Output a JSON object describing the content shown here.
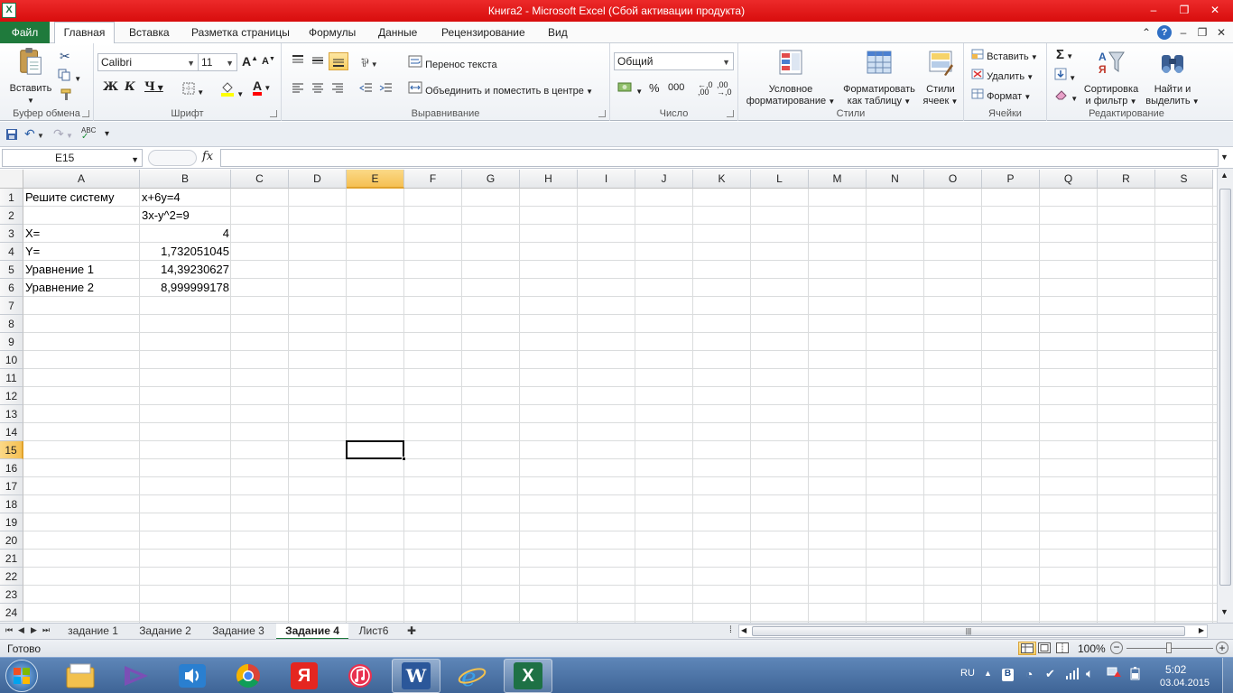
{
  "window": {
    "app_icon_letter": "X",
    "title": "Книга2  -  Microsoft Excel (Сбой активации продукта)",
    "minimize": "–",
    "restore": "❐",
    "close": "✕"
  },
  "ribbon_tabs": {
    "file": "Файл",
    "items": [
      "Главная",
      "Вставка",
      "Разметка страницы",
      "Формулы",
      "Данные",
      "Рецензирование",
      "Вид"
    ],
    "active_index": 0
  },
  "clipboard": {
    "paste": "Вставить",
    "label": "Буфер обмена"
  },
  "font": {
    "name": "Calibri",
    "size": "11",
    "grow": "A",
    "shrink": "A",
    "bold": "Ж",
    "italic": "К",
    "underline": "Ч",
    "font_color_letter": "A",
    "label": "Шрифт",
    "fill_color": "#ffff00",
    "text_color": "#ff0000"
  },
  "alignment": {
    "wrap": "Перенос текста",
    "merge": "Объединить и поместить в центре",
    "label": "Выравнивание"
  },
  "number": {
    "format": "Общий",
    "percent": "%",
    "thousands": "000",
    "label": "Число"
  },
  "styles": {
    "conditional_1": "Условное",
    "conditional_2": "форматирование",
    "as_table_1": "Форматировать",
    "as_table_2": "как таблицу",
    "cell_styles_1": "Стили",
    "cell_styles_2": "ячеек",
    "label": "Стили"
  },
  "cells_group": {
    "insert": "Вставить",
    "delete": "Удалить",
    "format": "Формат",
    "label": "Ячейки"
  },
  "editing": {
    "sum": "Σ",
    "sort_1": "Сортировка",
    "sort_2": "и фильтр",
    "find_1": "Найти и",
    "find_2": "выделить",
    "label": "Редактирование"
  },
  "formula_bar": {
    "name_box": "E15",
    "fx": "fx",
    "value": ""
  },
  "columns": [
    "A",
    "B",
    "C",
    "D",
    "E",
    "F",
    "G",
    "H",
    "I",
    "J",
    "K",
    "L",
    "M",
    "N",
    "O",
    "P",
    "Q",
    "R",
    "S"
  ],
  "rows": [
    "1",
    "2",
    "3",
    "4",
    "5",
    "6",
    "7",
    "8",
    "9",
    "10",
    "11",
    "12",
    "13",
    "14",
    "15",
    "16",
    "17",
    "18",
    "19",
    "20",
    "21",
    "22",
    "23",
    "24"
  ],
  "active_cell": "E15",
  "cells": {
    "A1": "Решите систему",
    "B1": "x+6y=4",
    "B2": "3x-y^2=9",
    "A3": "X=",
    "B3": "4",
    "A4": "Y=",
    "B4": "1,732051045",
    "A5": "Уравнение 1",
    "B5": "14,39230627",
    "A6": "Уравнение 2",
    "B6": "8,999999178"
  },
  "sheets": {
    "tabs": [
      "задание 1",
      "Задание 2",
      "Задание 3",
      "Задание 4",
      "Лист6"
    ],
    "active_index": 3
  },
  "status_bar": {
    "status": "Готово",
    "zoom": "100%"
  },
  "taskbar": {
    "lang": "RU",
    "time": "5:02",
    "date": "03.04.2015"
  }
}
